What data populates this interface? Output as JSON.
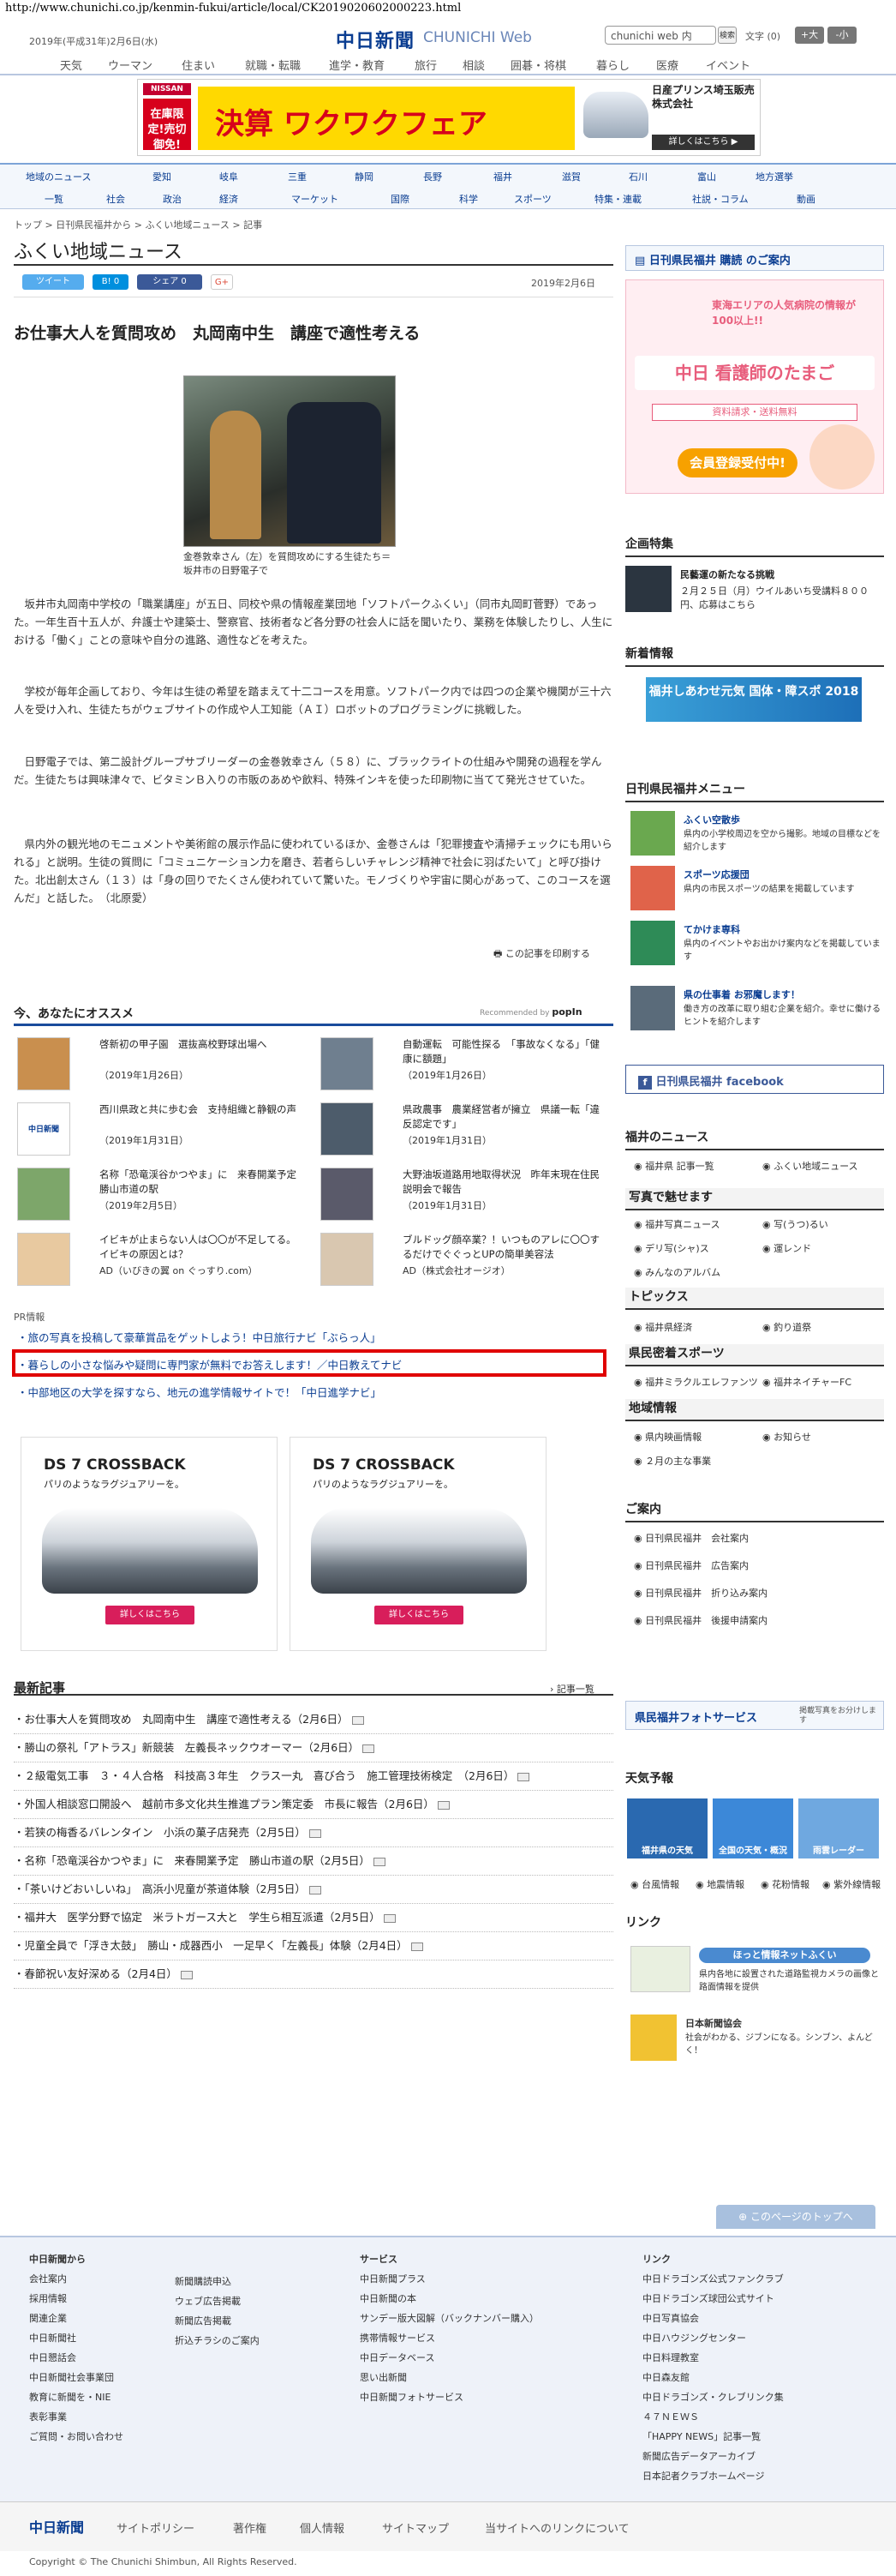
{
  "url": "http://www.chunichi.co.jp/kenmin-fukui/article/local/CK2019020602000223.html",
  "header": {
    "date": "2019年(平成31年)2月6日(水)",
    "logo": "中日新聞",
    "logo_sub": "CHUNICHI Web",
    "search_placeholder": "chunichi web 内",
    "search_btn": "検索",
    "font_size_label": "文字",
    "font_size_value": "(0)",
    "font_plus": "+大",
    "font_minus": "-小",
    "nav": [
      "天気",
      "ウーマン",
      "住まい",
      "就職・転職",
      "進学・教育",
      "旅行",
      "相談",
      "囲碁・将棋",
      "暮らし",
      "医療",
      "イベント"
    ]
  },
  "ad_banner": {
    "brand": "NISSAN",
    "badge": "在庫限定!売切御免!",
    "title": "決算 ワクワクフェア",
    "dealer": "日産プリンス埼玉販売株式会社",
    "detail": "詳しくはこちら ▶"
  },
  "subnav": {
    "row1": [
      "地域のニュース",
      "愛知",
      "岐阜",
      "三重",
      "静岡",
      "長野",
      "福井",
      "滋賀",
      "石川",
      "富山",
      "地方選挙"
    ],
    "row2": [
      "一覧",
      "社会",
      "政治",
      "経済",
      "マーケット",
      "国際",
      "科学",
      "スポーツ",
      "特集・連載",
      "社説・コラム",
      "動画"
    ]
  },
  "breadcrumb": "トップ > 日刊県民福井から > ふくい地域ニュース > 記事",
  "section_title": "ふくい地域ニュース",
  "share": {
    "tweet": "ツイート",
    "hatena": "B! 0",
    "facebook": "シェア 0",
    "gplus": "G+"
  },
  "article": {
    "date": "2019年2月6日",
    "headline": "お仕事大人を質問攻め　丸岡南中生　講座で適性考える",
    "caption": "金巻敦幸さん（左）を質問攻めにする生徒たち＝坂井市の日野電子で",
    "paragraphs": [
      "坂井市丸岡南中学校の「職業講座」が五日、同校や県の情報産業団地「ソフトパークふくい」（同市丸岡町菅野）であった。一年生百十五人が、弁護士や建築士、警察官、技術者など各分野の社会人に話を聞いたり、業務を体験したりし、人生における「働く」ことの意味や自分の進路、適性などを考えた。",
      "学校が毎年企画しており、今年は生徒の希望を踏まえて十二コースを用意。ソフトパーク内では四つの企業や機関が三十六人を受け入れ、生徒たちがウェブサイトの作成や人工知能（ＡＩ）ロボットのプログラミングに挑戦した。",
      "日野電子では、第二設計グループサブリーダーの金巻敦幸さん（５８）に、ブラックライトの仕組みや開発の過程を学んだ。生徒たちは興味津々で、ビタミンＢ入りの市販のあめや飲料、特殊インキを使った印刷物に当てて発光させていた。",
      "県内外の観光地のモニュメントや美術館の展示作品に使われているほか、金巻さんは「犯罪捜査や清掃チェックにも用いられる」と説明。生徒の質問に「コミュニケーション力を磨き、若者らしいチャレンジ精神で社会に羽ばたいて」と呼び掛けた。北出創太さん（１３）は「身の回りでたくさん使われていて驚いた。モノづくりや宇宙に関心があって、このコースを選んだ」と話した。　（北原愛）"
    ],
    "print": "この記事を印刷する"
  },
  "recommend": {
    "title": "今、あなたにオススメ",
    "by": "Recommended by",
    "popin": "popIn",
    "items": [
      {
        "text": "啓新初の甲子園　選抜高校野球出場へ",
        "date": "（2019年1月26日）"
      },
      {
        "text": "自動運転　可能性探る　「事故なくなる」「健康に額題」",
        "date": "（2019年1月26日）"
      },
      {
        "text": "西川県政と共に歩む会　支持組織と静観の声",
        "date": "（2019年1月31日）"
      },
      {
        "text": "県政農事　農業経営者が擁立　県議一転「違反認定です」",
        "date": "（2019年1月31日）"
      },
      {
        "text": "名称「恐竜渓谷かつやま」に　来春開業予定　勝山市道の駅",
        "date": "（2019年2月5日）"
      },
      {
        "text": "大野油坂道路用地取得状況　昨年末現在住民説明会で報告",
        "date": "（2019年1月31日）"
      },
      {
        "text": "イビキが止まらない人は〇〇が不足してる。イビキの原因とは？",
        "date": "AD（いびきの翼 on ぐっすり.com）"
      },
      {
        "text": "ブルドッグ顔卒業？！いつものアレに〇〇するだけでぐぐっとUPの簡単美容法",
        "date": "AD（株式会社オージオ）"
      }
    ]
  },
  "pr": {
    "label": "PR情報",
    "items": [
      "旅の写真を投稿して豪華賞品をゲットしよう！中日旅行ナビ「ぶらっ人」",
      "暮らしの小さな悩みや疑問に専門家が無料でお答えします！／中日教えてナビ",
      "中部地区の大学を探すなら、地元の進学情報サイトで！「中日進学ナビ」"
    ]
  },
  "ds_ad": {
    "title": "DS 7 CROSSBACK",
    "sub": "パリのようなラグジュアリーを。",
    "btn": "詳しくはこちら"
  },
  "latest": {
    "title": "最新記事",
    "more": "記事一覧",
    "items": [
      "お仕事大人を質問攻め　丸岡南中生　講座で適性考える（2月6日）",
      "勝山の祭礼「アトラス」新競装　左義長ネックウオーマー（2月6日）",
      "２級電気工事　３・４人合格　科技高３年生　クラス一丸　喜び合う　施工管理技術検定　（2月6日）",
      "外国人相談窓口開設へ　越前市多文化共生推進プラン策定委　市長に報告（2月6日）",
      "若狭の梅香るバレンタイン　小浜の菓子店発売（2月5日）",
      "名称「恐竜渓谷かつやま」に　来春開業予定　勝山市道の駅（2月5日）",
      "「茶いけどおいしいね」　高浜小児童が茶道体験（2月5日）",
      "福井大　医学分野で協定　米ラトガース大と　学生ら相互派遣（2月5日）",
      "児童全員で「浮き太鼓」　勝山・成器西小　一足早く「左義長」体験（2月4日）",
      "春節祝い友好深める（2月4日）"
    ]
  },
  "sidebar": {
    "subscribe": "日刊県民福井 購読 のご案内",
    "nurse_ad": {
      "line1": "東海エリアの人気病院の情報が100以上!!",
      "title": "中日 看護師のたまご",
      "line2": "資料請求・送料無料",
      "line3": "会員登録受付中!"
    },
    "kikaku": {
      "title": "企画特集",
      "item": "民藝運の新たなる挑戦",
      "detail": "２月２５日（月）ウイルあいち受講料８００円、応募はこちら"
    },
    "shinchaku": {
      "title": "新着情報",
      "banner": "福井しあわせ元気 国体・障スポ 2018"
    },
    "menu": {
      "title": "日刊県民福井メニュー",
      "items": [
        {
          "name": "ふくい空散歩",
          "desc": "県内の小学校周辺を空から撮影。地域の目標などを紹介します"
        },
        {
          "name": "スポーツ応援団",
          "desc": "県内の市民スポーツの結果を掲載しています"
        },
        {
          "name": "てかけま専科",
          "desc": "県内のイベントやお出かけ案内などを掲載しています"
        },
        {
          "name": "県の仕事着 お邪魔します！",
          "desc": "働き方の改革に取り組む企業を紹介。幸せに働けるヒントを紹介します"
        }
      ],
      "fb": "日刊県民福井 facebook"
    },
    "fukui_news": {
      "title": "福井のニュース",
      "links": [
        "福井県 記事一覧",
        "ふくい地域ニュース"
      ]
    },
    "photo": {
      "title": "写真で魅せます",
      "links": [
        "福井写真ニュース",
        "写(うつ)るい",
        "デリ写(シャ)ス",
        "運レンド",
        "みんなのアルバム"
      ]
    },
    "topics": {
      "title": "トピックス",
      "links": [
        "福井県経済",
        "釣り道祭"
      ]
    },
    "sports": {
      "title": "県民密着スポーツ",
      "links": [
        "福井ミラクルエレファンツ",
        "福井ネイチャーFC"
      ]
    },
    "local": {
      "title": "地域情報",
      "links": [
        "県内映画情報",
        "お知らせ",
        "２月の主な事業"
      ]
    },
    "annai": {
      "title": "ご案内",
      "links": [
        "日刊県民福井　会社案内",
        "日刊県民福井　広告案内",
        "日刊県民福井　折り込み案内",
        "日刊県民福井　後援申請案内"
      ]
    },
    "photoservice": {
      "title": "県民福井フォトサービス",
      "sub": "掲載写真をお分けします"
    },
    "weather": {
      "title": "天気予報",
      "tiles": [
        "福井県の天気",
        "全国の天気・概況",
        "雨雲レーダー"
      ],
      "links": [
        "台風情報",
        "地震情報",
        "花粉情報",
        "紫外線情報"
      ]
    },
    "link": {
      "title": "リンク",
      "items": [
        {
          "name": "ほっと情報ネットふくい",
          "desc": "県内各地に設置された道路監視カメラの画像と路面情報を提供"
        },
        {
          "name": "日本新聞協会",
          "desc": "社会がわかる、ジブンになる。シンブン、よんどく！"
        }
      ]
    }
  },
  "back_to_top": "このページのトップへ",
  "footer": {
    "col1_title": "中日新聞から",
    "col1": [
      "会社案内",
      "採用情報",
      "関連企業",
      "中日新聞社",
      "中日懇話会",
      "中日新聞社会事業団",
      "教育に新聞を・NIE",
      "表彰事業",
      "ご質問・お問い合わせ"
    ],
    "col2": [
      "新聞購読申込",
      "ウェブ広告掲載",
      "新聞広告掲載",
      "折込チラシのご案内"
    ],
    "col3_title": "サービス",
    "col3": [
      "中日新聞プラス",
      "中日新聞の本",
      "サンデー版大図解（バックナンバー購入）",
      "携帯情報サービス",
      "中日データベース",
      "思い出新聞",
      "中日新聞フォトサービス"
    ],
    "col4_title": "リンク",
    "col4": [
      "中日ドラゴンズ公式ファンクラブ",
      "中日ドラゴンズ球団公式サイト",
      "中日写真協会",
      "中日ハウジングセンター",
      "中日料理教室",
      "中日森友館",
      "中日ドラゴンズ・クレブリンク集",
      "４７ＮＥＷＳ",
      "「HAPPY NEWS」記事一覧",
      "新聞広告データアーカイブ",
      "日本記者クラブホームページ"
    ],
    "bar": [
      "中日新聞",
      "サイトポリシー",
      "著作権",
      "個人情報",
      "サイトマップ",
      "当サイトへのリンクについて"
    ],
    "copyright": "Copyright © The Chunichi Shimbun, All Rights Reserved."
  },
  "colors": {
    "brand": "#0a3d91",
    "accent_red": "#e00000",
    "nurse_pink": "#e85d7c"
  }
}
